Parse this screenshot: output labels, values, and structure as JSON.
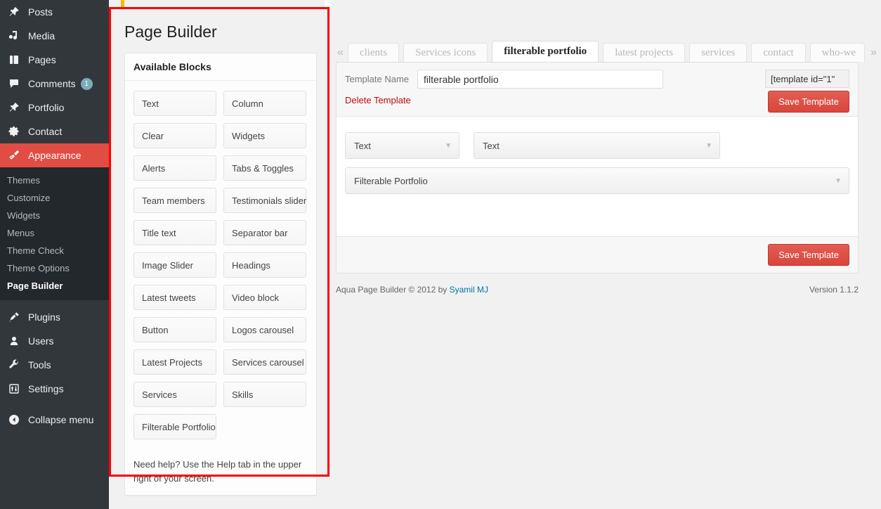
{
  "admin_menu": {
    "top_items": [
      {
        "label": "Posts",
        "icon": "pin-icon",
        "badge": null
      },
      {
        "label": "Media",
        "icon": "media-icon",
        "badge": null
      },
      {
        "label": "Pages",
        "icon": "pages-icon",
        "badge": null
      },
      {
        "label": "Comments",
        "icon": "comment-icon",
        "badge": "1"
      },
      {
        "label": "Portfolio",
        "icon": "pin-icon",
        "badge": null
      },
      {
        "label": "Contact",
        "icon": "gear-icon",
        "badge": null
      }
    ],
    "current_item": {
      "label": "Appearance",
      "icon": "brush-icon"
    },
    "submenu": [
      {
        "label": "Themes",
        "current": false
      },
      {
        "label": "Customize",
        "current": false
      },
      {
        "label": "Widgets",
        "current": false
      },
      {
        "label": "Menus",
        "current": false
      },
      {
        "label": "Theme Check",
        "current": false
      },
      {
        "label": "Theme Options",
        "current": false
      },
      {
        "label": "Page Builder",
        "current": true
      }
    ],
    "bottom_items": [
      {
        "label": "Plugins",
        "icon": "plug-icon"
      },
      {
        "label": "Users",
        "icon": "user-icon"
      },
      {
        "label": "Tools",
        "icon": "wrench-icon"
      },
      {
        "label": "Settings",
        "icon": "sliders-icon"
      }
    ],
    "collapse": {
      "label": "Collapse menu",
      "icon": "collapse-arrow-icon"
    },
    "colors": {
      "menu_bg": "#32373c",
      "submenu_bg": "#23282d",
      "current_bg": "#e14d43",
      "badge_bg": "#7badb8"
    }
  },
  "page_builder": {
    "title": "Page Builder",
    "available_blocks": {
      "header": "Available Blocks",
      "items": [
        "Text",
        "Column",
        "Clear",
        "Widgets",
        "Alerts",
        "Tabs & Toggles",
        "Team members",
        "Testimonials slider",
        "Title text",
        "Separator bar",
        "Image Slider",
        "Headings",
        "Latest tweets",
        "Video block",
        "Button",
        "Logos carousel",
        "Latest Projects",
        "Services carousel",
        "Services",
        "Skills",
        "Filterable Portfolio"
      ],
      "help_text": "Need help? Use the Help tab in the upper right of your screen."
    }
  },
  "templates": {
    "prev_arrow": "«",
    "next_arrow": "»",
    "tabs": [
      {
        "label": "clients",
        "active": false
      },
      {
        "label": "Services icons",
        "active": false
      },
      {
        "label": "filterable portfolio",
        "active": true
      },
      {
        "label": "latest projects",
        "active": false
      },
      {
        "label": "services",
        "active": false
      },
      {
        "label": "contact",
        "active": false
      },
      {
        "label": "who-we",
        "active": false
      }
    ],
    "template_name_label": "Template Name",
    "template_name_value": "filterable portfolio",
    "template_name_placeholder": "Template Name",
    "shortcode": "[template id=\"1\"",
    "delete_label": "Delete Template",
    "save_label_top": "Save Template",
    "save_label_bottom": "Save Template",
    "blocks": [
      [
        {
          "label": "Text",
          "width": "small"
        },
        {
          "label": "Text",
          "width": "medium"
        }
      ],
      [
        {
          "label": "Filterable Portfolio",
          "width": "full"
        }
      ]
    ]
  },
  "footer": {
    "credit_prefix": "Aqua Page Builder © 2012 by ",
    "credit_link": "Syamil MJ",
    "version": "Version 1.1.2"
  },
  "colors": {
    "accent_red": "#e14d43",
    "annotation_red": "#ff0000",
    "link_blue": "#0073aa",
    "delete_red": "#bc0b0b"
  }
}
